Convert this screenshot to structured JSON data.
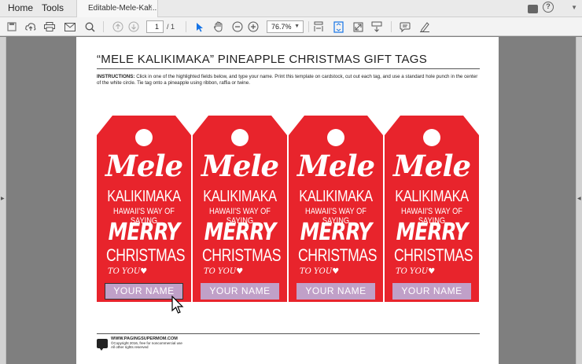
{
  "tabbar": {
    "home_label": "Home",
    "tools_label": "Tools",
    "doc_tab_label": "Editable-Mele-Kal...",
    "close_glyph": "×",
    "help_glyph": "?"
  },
  "toolbar": {
    "page_current": "1",
    "page_total": "/ 1",
    "zoom_value": "76.7%",
    "icons": [
      "save-icon",
      "upload-icon",
      "print-icon",
      "email-icon",
      "search-icon",
      "page-up-icon",
      "page-down-icon",
      "select-arrow-icon",
      "hand-tool-icon",
      "zoom-out-icon",
      "zoom-in-icon",
      "fit-page-icon",
      "page-view-icon",
      "fullscreen-icon",
      "scroll-mode-icon",
      "comment-icon",
      "sign-icon"
    ]
  },
  "document": {
    "title": "“MELE KALIKIMAKA” PINEAPPLE CHRISTMAS GIFT TAGS",
    "instructions_label": "INSTRUCTIONS:",
    "instructions_text": " Click in one of the highlighted fields below, and type your name. Print this template on cardstock, cut out each tag, and use a standard hole punch in the center of the white circle. Tie tag onto a pineapple using ribbon, raffia or twine.",
    "tags": [
      {
        "mele": "Mele",
        "kali": "KALIKIMAKA",
        "hawaii": "HAWAII'S WAY OF SAYING",
        "merry": "MERRY",
        "christmas": "CHRISTMAS",
        "toyou": "TO YOU",
        "name_field": "YOUR NAME"
      },
      {
        "mele": "Mele",
        "kali": "KALIKIMAKA",
        "hawaii": "HAWAII'S WAY OF SAYING",
        "merry": "MERRY",
        "christmas": "CHRISTMAS",
        "toyou": "TO YOU",
        "name_field": "YOUR NAME"
      },
      {
        "mele": "Mele",
        "kali": "KALIKIMAKA",
        "hawaii": "HAWAII'S WAY OF SAYING",
        "merry": "MERRY",
        "christmas": "CHRISTMAS",
        "toyou": "TO YOU",
        "name_field": "YOUR NAME"
      },
      {
        "mele": "Mele",
        "kali": "KALIKIMAKA",
        "hawaii": "HAWAII'S WAY OF SAYING",
        "merry": "MERRY",
        "christmas": "CHRISTMAS",
        "toyou": "TO YOU",
        "name_field": "YOUR NAME"
      }
    ],
    "footer": {
      "site": "WWW.PAGINGSUPERMOM.COM",
      "copyright": "©Copyright 2016, free for noncommercial use",
      "rights": "All other rights reserved"
    }
  },
  "colors": {
    "tag_red": "#e8242c",
    "name_field": "#c0a0c8",
    "accent_blue": "#1473e6"
  }
}
